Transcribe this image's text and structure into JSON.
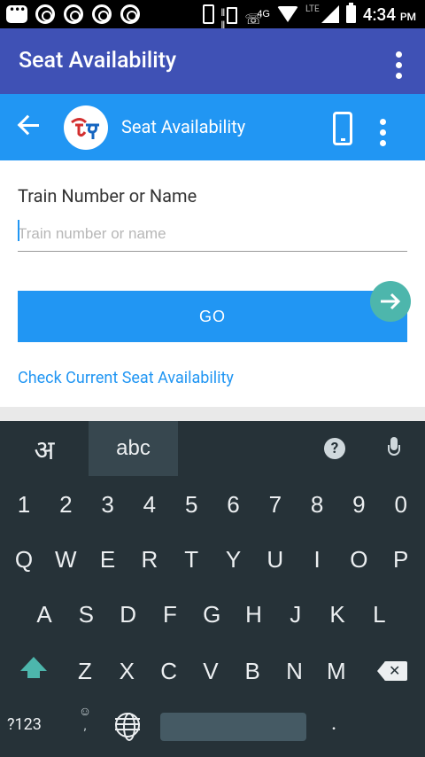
{
  "status_bar": {
    "time": "4:34",
    "ampm": "PM",
    "network_label": "4G",
    "lte_label": "LTE"
  },
  "app_bar": {
    "title": "Seat Availability"
  },
  "sub_bar": {
    "title": "Seat Availability"
  },
  "form": {
    "field_label": "Train Number or Name",
    "input_placeholder": "Train number or name",
    "input_value": "",
    "go_label": "GO",
    "link_label": "Check Current Seat Availability"
  },
  "keyboard": {
    "lang_hindi": "अ",
    "lang_english": "abc",
    "help_label": "?",
    "number_row": [
      "1",
      "2",
      "3",
      "4",
      "5",
      "6",
      "7",
      "8",
      "9",
      "0"
    ],
    "row1": [
      "Q",
      "W",
      "E",
      "R",
      "T",
      "Y",
      "U",
      "I",
      "O",
      "P"
    ],
    "row2": [
      "A",
      "S",
      "D",
      "F",
      "G",
      "H",
      "J",
      "K",
      "L"
    ],
    "row3": [
      "Z",
      "X",
      "C",
      "V",
      "B",
      "N",
      "M"
    ],
    "symbols_label": "?123",
    "emoji_label": "☺",
    "comma_label": ",",
    "period_label": "."
  },
  "colors": {
    "app_bar": "#3f51b5",
    "sub_bar": "#2196f3",
    "accent": "#2196f3",
    "keyboard_bg": "#263238",
    "keyboard_accent": "#4db6ac"
  }
}
